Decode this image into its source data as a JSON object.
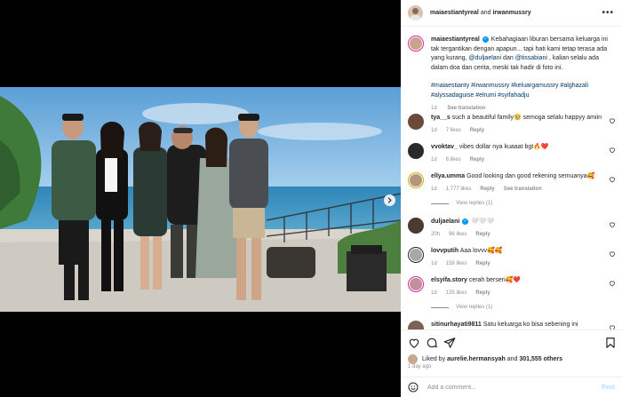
{
  "header": {
    "username": "maiaestiantyreal",
    "connector": "and",
    "coauthor": "irwanmussry"
  },
  "caption": {
    "username": "maiaestiantyreal",
    "text_1": "Kebahagiaan liburan bersama keluarga ini tak tergantikan dengan apapun... tapi hati kami tetap terasa ada yang kurang, ",
    "mention_1": "@duljaelani",
    "text_2": " dan ",
    "mention_2": "@tissabiani",
    "text_3": " , kalian selalu ada dalam doa dan cerita, meski tak hadir di foto ini.",
    "hashtags": "#maiaestianty #irwanmussry #keluargamussry #alghazali #alyssadaguise #elrumi #syifahadju",
    "age": "1d",
    "see_translation": "See translation"
  },
  "comments": [
    {
      "username": "tya__s",
      "text": "such a beautiful family🥹 semoga selalu happyy amiin",
      "age": "1d",
      "likes": "7 likes",
      "reply": "Reply"
    },
    {
      "username": "vvoktav_",
      "text": "vibes dollar nya kuaaat bgt🔥❤️",
      "age": "1d",
      "likes": "6 likes",
      "reply": "Reply"
    },
    {
      "username": "ellya.umma",
      "text": "Good looking dan good rekening semuanya🥰",
      "age": "1d",
      "likes": "1,777 likes",
      "reply": "Reply",
      "see_translation": "See translation",
      "view_replies": "View replies (1)"
    },
    {
      "username": "duljaelani",
      "text": "🤍🤍🤍",
      "age": "20h",
      "likes": "96 likes",
      "reply": "Reply",
      "verified": true
    },
    {
      "username": "lovvputih",
      "text": "Aaa lovvv🥰🥰",
      "age": "1d",
      "likes": "158 likes",
      "reply": "Reply"
    },
    {
      "username": "elsyifa.story",
      "text": "cerah berseri🥰❤️",
      "age": "1d",
      "likes": "135 likes",
      "reply": "Reply",
      "view_replies": "View replies (1)"
    },
    {
      "username": "sitinurhayati9811",
      "text": "Satu keluarga ko bisa sebening ini"
    }
  ],
  "likes": {
    "prefix": "Liked by",
    "user": "aurelie.hermansyah",
    "connector": "and",
    "count": "301,555 others"
  },
  "time_ago": "1 day ago",
  "add_comment": {
    "placeholder": "Add a comment...",
    "post_label": "Post"
  },
  "colors": {
    "link": "#00376b",
    "verified": "#0095f6",
    "muted": "#8e8e8e",
    "post_disabled": "#b2dffc"
  }
}
